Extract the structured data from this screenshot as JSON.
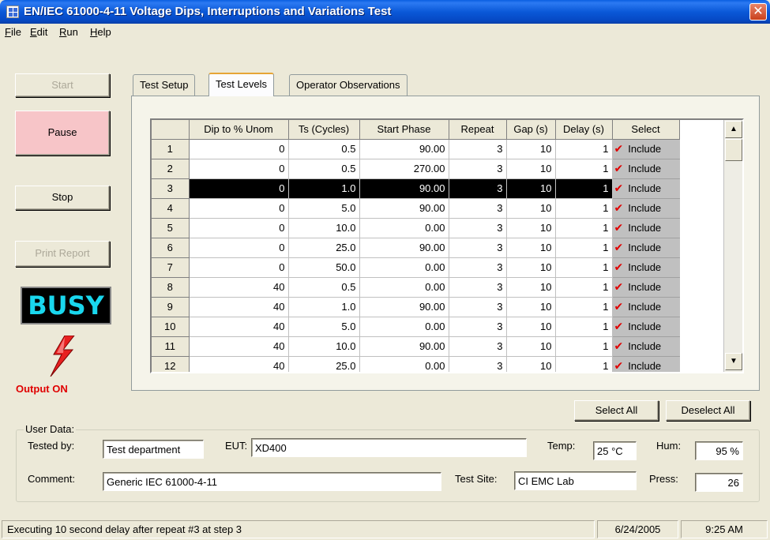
{
  "window": {
    "title": "EN/IEC 61000-4-11 Voltage Dips, Interruptions and Variations Test"
  },
  "menu": [
    {
      "label": "File",
      "accel": "F",
      "rest": "ile"
    },
    {
      "label": "Edit",
      "accel": "E",
      "rest": "dit"
    },
    {
      "label": "Run",
      "accel": "R",
      "rest": "un"
    },
    {
      "label": "Help",
      "accel": "H",
      "rest": "elp"
    }
  ],
  "controls": {
    "start_label": "Start",
    "pause_label": "Pause",
    "stop_label": "Stop",
    "print_label": "Print Report",
    "busy_text": "BUSY",
    "output_status": "Output ON"
  },
  "tabs": [
    {
      "label": "Test Setup"
    },
    {
      "label": "Test Levels"
    },
    {
      "label": "Operator Observations"
    }
  ],
  "grid": {
    "columns": [
      "",
      "Dip to % Unom",
      "Ts (Cycles)",
      "Start Phase",
      "Repeat",
      "Gap (s)",
      "Delay (s)",
      "Select"
    ],
    "rows": [
      {
        "n": "1",
        "dip": "0",
        "ts": "0.5",
        "phase": "90.00",
        "repeat": "3",
        "gap": "10",
        "delay": "1",
        "select": "Include"
      },
      {
        "n": "2",
        "dip": "0",
        "ts": "0.5",
        "phase": "270.00",
        "repeat": "3",
        "gap": "10",
        "delay": "1",
        "select": "Include"
      },
      {
        "n": "3",
        "dip": "0",
        "ts": "1.0",
        "phase": "90.00",
        "repeat": "3",
        "gap": "10",
        "delay": "1",
        "select": "Include"
      },
      {
        "n": "4",
        "dip": "0",
        "ts": "5.0",
        "phase": "90.00",
        "repeat": "3",
        "gap": "10",
        "delay": "1",
        "select": "Include"
      },
      {
        "n": "5",
        "dip": "0",
        "ts": "10.0",
        "phase": "0.00",
        "repeat": "3",
        "gap": "10",
        "delay": "1",
        "select": "Include"
      },
      {
        "n": "6",
        "dip": "0",
        "ts": "25.0",
        "phase": "90.00",
        "repeat": "3",
        "gap": "10",
        "delay": "1",
        "select": "Include"
      },
      {
        "n": "7",
        "dip": "0",
        "ts": "50.0",
        "phase": "0.00",
        "repeat": "3",
        "gap": "10",
        "delay": "1",
        "select": "Include"
      },
      {
        "n": "8",
        "dip": "40",
        "ts": "0.5",
        "phase": "0.00",
        "repeat": "3",
        "gap": "10",
        "delay": "1",
        "select": "Include"
      },
      {
        "n": "9",
        "dip": "40",
        "ts": "1.0",
        "phase": "90.00",
        "repeat": "3",
        "gap": "10",
        "delay": "1",
        "select": "Include"
      },
      {
        "n": "10",
        "dip": "40",
        "ts": "5.0",
        "phase": "0.00",
        "repeat": "3",
        "gap": "10",
        "delay": "1",
        "select": "Include"
      },
      {
        "n": "11",
        "dip": "40",
        "ts": "10.0",
        "phase": "90.00",
        "repeat": "3",
        "gap": "10",
        "delay": "1",
        "select": "Include"
      },
      {
        "n": "12",
        "dip": "40",
        "ts": "25.0",
        "phase": "0.00",
        "repeat": "3",
        "gap": "10",
        "delay": "1",
        "select": "Include"
      }
    ],
    "highlighted_row": 3,
    "checkbox_color": "#e00000"
  },
  "buttons": {
    "select_all": "Select All",
    "deselect_all": "Deselect All"
  },
  "user_data": {
    "group_label": "User Data:",
    "tested_by_label": "Tested by:",
    "tested_by": "Test department",
    "eut_label": "EUT:",
    "eut": "XD400",
    "temp_label": "Temp:",
    "temp": "25 °C",
    "hum_label": "Hum:",
    "hum": "95 %",
    "comment_label": "Comment:",
    "comment": "Generic IEC 61000-4-11",
    "site_label": "Test Site:",
    "site": "CI EMC Lab",
    "press_label": "Press:",
    "press": "26"
  },
  "status": {
    "message": "Executing 10 second delay after repeat #3 at step 3",
    "date": "6/24/2005",
    "time": "9:25 AM"
  }
}
